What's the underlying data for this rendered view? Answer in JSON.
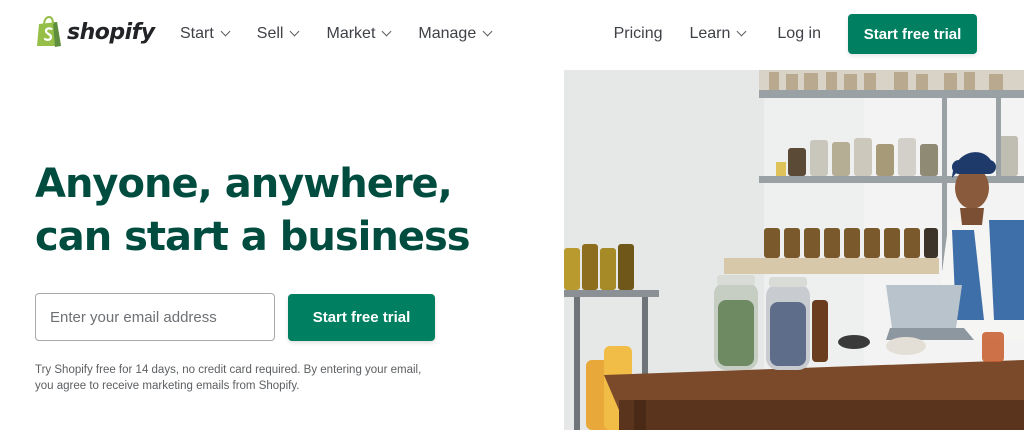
{
  "brand": {
    "name": "shopify",
    "color": "#95bf47",
    "primary": "#008060",
    "headline_color": "#004c3f"
  },
  "nav": {
    "items": [
      {
        "label": "Start",
        "has_dropdown": true
      },
      {
        "label": "Sell",
        "has_dropdown": true
      },
      {
        "label": "Market",
        "has_dropdown": true
      },
      {
        "label": "Manage",
        "has_dropdown": true
      }
    ],
    "pricing": "Pricing",
    "learn": "Learn",
    "login": "Log in",
    "cta": "Start free trial"
  },
  "hero": {
    "headline_line1": "Anyone, anywhere,",
    "headline_line2": "can start a business",
    "email_placeholder": "Enter your email address",
    "cta": "Start free trial",
    "disclaimer": "Try Shopify free for 14 days, no credit card required. By entering your email, you agree to receive marketing emails from Shopify."
  },
  "icons": [
    "shopify-bag-icon",
    "chevron-down-icon"
  ]
}
